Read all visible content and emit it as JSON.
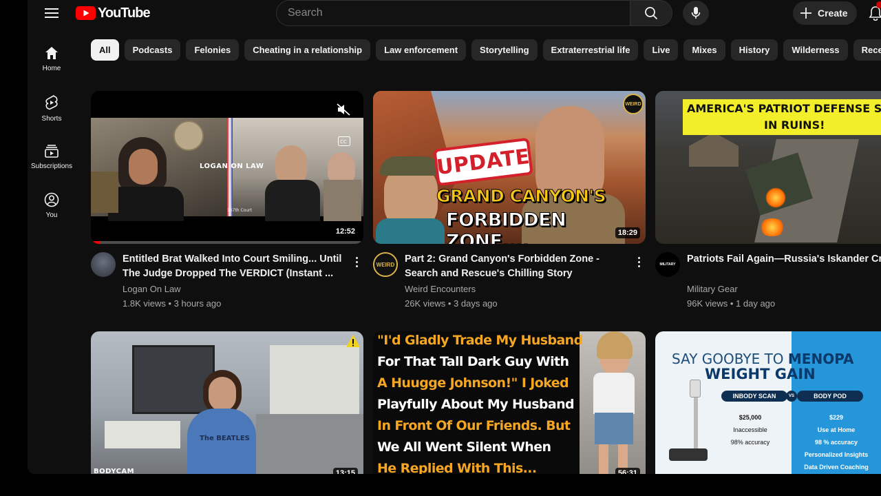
{
  "topbar": {
    "logo_text": "YouTube",
    "search_placeholder": "Search",
    "create_label": "Create"
  },
  "nav": [
    {
      "label": "Home",
      "icon": "home-icon"
    },
    {
      "label": "Shorts",
      "icon": "shorts-icon"
    },
    {
      "label": "Subscriptions",
      "icon": "subscriptions-icon"
    },
    {
      "label": "You",
      "icon": "user-icon"
    }
  ],
  "chips": [
    "All",
    "Podcasts",
    "Felonies",
    "Cheating in a relationship",
    "Law enforcement",
    "Storytelling",
    "Extraterrestrial life",
    "Live",
    "Mixes",
    "History",
    "Wilderness",
    "Rece"
  ],
  "videos": [
    {
      "title": "Entitled Brat Walked Into Court Smiling... Until The Judge Dropped The VERDICT (Instant ...",
      "channel": "Logan On Law",
      "stats": "1.8K views • 3 hours ago",
      "duration": "12:52",
      "watermark": "LOGAN ON LAW",
      "court_label": "167th Court",
      "progress": 0.035
    },
    {
      "title": "Part 2: Grand Canyon's Forbidden Zone - Search and Rescue's Chilling Story",
      "channel": "Weird Encounters",
      "stats": "26K views • 3 days ago",
      "duration": "18:29",
      "badge": "UPDATE",
      "line1": "GRAND CANYON'S",
      "line2": "FORBIDDEN ZONE....",
      "avatar_text": "WEIRD"
    },
    {
      "title": "Patriots Fail Again—Russia's Iskander Crushes the \"Unbreakable\" Defense!",
      "channel": "Military Gear",
      "stats": "96K views • 1 day ago",
      "headline1": "AMERICA'S PATRIOT DEFENSE SYST",
      "headline2": "IN RUINS!",
      "avatar_text": "MILITARY"
    },
    {
      "duration": "13:15",
      "corner_label": "BODYCAM",
      "shirt_text": "The BEATLES"
    },
    {
      "duration": "56:31",
      "lines": [
        {
          "text": "\"I'd Gladly Trade My Husband",
          "color": "#f5a623"
        },
        {
          "text": "For That Tall Dark Guy With",
          "color": "#ffffff"
        },
        {
          "text": "A Huugge Johnson!\" I Joked",
          "color": "#f5a623"
        },
        {
          "text": "Playfully About My Husband",
          "color": "#ffffff"
        },
        {
          "text": "In Front Of Our Friends. But",
          "color": "#f5a623"
        },
        {
          "text": "We All Went Silent When",
          "color": "#ffffff"
        },
        {
          "text": "He Replied With This...",
          "color": "#f5a623"
        }
      ]
    },
    {
      "ad_line1a": "SAY GOOBYE TO ",
      "ad_line1b": "MENOPA",
      "ad_line2": "WEIGHT GAIN",
      "left_pill": "INBODY SCAN",
      "vs": "VS",
      "right_pill": "BODY POD",
      "left_points": [
        "$25,000",
        "Inaccessible",
        "98% accuracy"
      ],
      "right_points": [
        "$229",
        "Use at Home",
        "98 % accuracy",
        "Personalized Insights",
        "Data Driven Coaching"
      ]
    }
  ],
  "colors": {
    "brand_red": "#ff0000",
    "bg": "#0f0f0f",
    "chip": "#272727"
  }
}
